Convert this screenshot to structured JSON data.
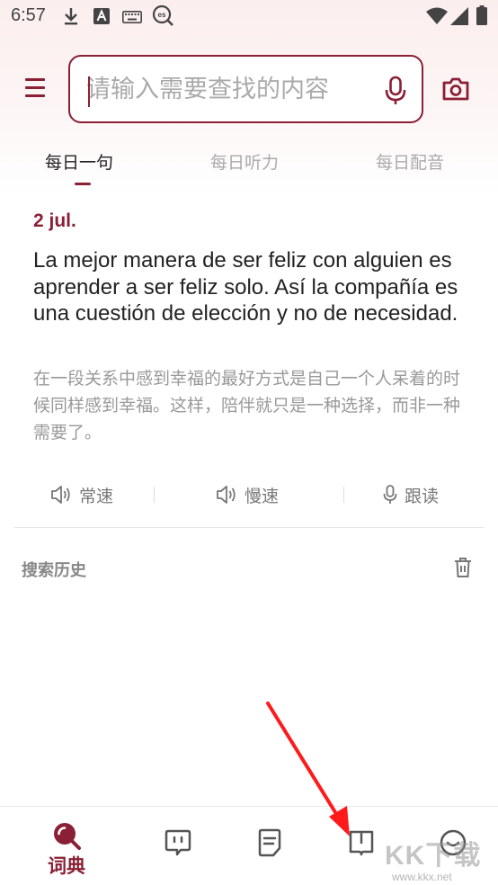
{
  "status_bar": {
    "time": "6:57",
    "left_icons": [
      "download-icon",
      "text-a-icon",
      "keyboard-icon",
      "es-search-icon"
    ],
    "right_icons": [
      "wifi-icon",
      "signal-icon",
      "battery-icon"
    ]
  },
  "search": {
    "placeholder": "请输入需要查找的内容",
    "value": "",
    "icons": [
      "menu-icon",
      "mic-icon",
      "camera-icon"
    ]
  },
  "tabs": [
    {
      "label": "每日一句",
      "active": true
    },
    {
      "label": "每日听力",
      "active": false
    },
    {
      "label": "每日配音",
      "active": false
    }
  ],
  "daily": {
    "date": "2 jul.",
    "sentence_es": "La mejor manera de ser feliz con alguien es aprender a ser feliz solo. Así la compañía es una cuestión de elección y no de necesidad.",
    "sentence_zh": "在一段关系中感到幸福的最好方式是自己一个人呆着的时候同样感到幸福。这样，陪伴就只是一种选择，而非一种需要了。",
    "actions": [
      {
        "label": "常速",
        "icon": "speaker-icon"
      },
      {
        "label": "慢速",
        "icon": "speaker-icon"
      },
      {
        "label": "跟读",
        "icon": "mic-icon"
      }
    ]
  },
  "history": {
    "title": "搜索历史",
    "icon": "trash-icon"
  },
  "bottom_nav": [
    {
      "label": "词典",
      "icon": "dictionary-search-icon",
      "active": true
    },
    {
      "label": "",
      "icon": "chat-bubble-icon",
      "active": false
    },
    {
      "label": "",
      "icon": "document-icon",
      "active": false
    },
    {
      "label": "",
      "icon": "book-icon",
      "active": false
    },
    {
      "label": "",
      "icon": "profile-icon",
      "active": false
    }
  ],
  "watermark": {
    "text": "KK下载",
    "url": "www.kkx.net"
  },
  "colors": {
    "accent": "#8a1f35",
    "header_tint": "#fbeeee",
    "muted_text": "#999999",
    "arrow": "#ff1a1a"
  }
}
